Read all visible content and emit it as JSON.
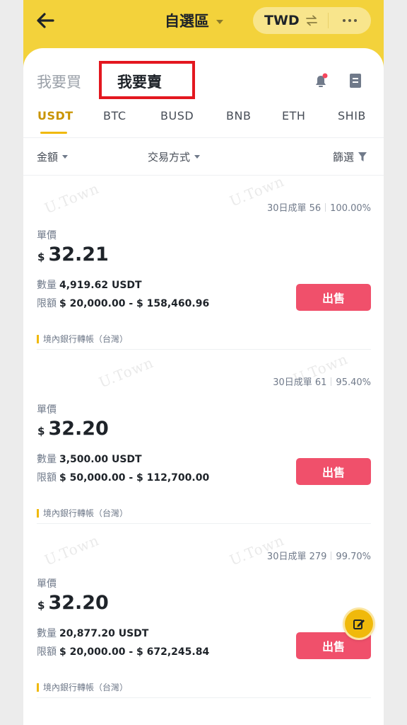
{
  "header": {
    "title": "自選區",
    "currency": "TWD"
  },
  "mode_tabs": {
    "buy": "我要買",
    "sell": "我要賣"
  },
  "coin_tabs": [
    "USDT",
    "BTC",
    "BUSD",
    "BNB",
    "ETH",
    "SHIB"
  ],
  "active_coin": "USDT",
  "filters": {
    "amount": "金額",
    "payment": "交易方式",
    "filter": "篩選"
  },
  "watermark_text": "U.Town",
  "ads": [
    {
      "stats_label": "30日成單 56",
      "completion": "100.00%",
      "price_label": "單價",
      "currency_symbol": "$",
      "price": "32.21",
      "qty_label": "數量",
      "qty": "4,919.62 USDT",
      "limit_label": "限額",
      "limit": "$ 20,000.00 - $ 158,460.96",
      "button": "出售",
      "payment": "境內銀行轉帳（台灣）"
    },
    {
      "stats_label": "30日成單 61",
      "completion": "95.40%",
      "price_label": "單價",
      "currency_symbol": "$",
      "price": "32.20",
      "qty_label": "數量",
      "qty": "3,500.00 USDT",
      "limit_label": "限額",
      "limit": "$ 50,000.00 - $ 112,700.00",
      "button": "出售",
      "payment": "境內銀行轉帳（台灣）"
    },
    {
      "stats_label": "30日成單 279",
      "completion": "99.70%",
      "price_label": "單價",
      "currency_symbol": "$",
      "price": "32.20",
      "qty_label": "數量",
      "qty": "20,877.20 USDT",
      "limit_label": "限額",
      "limit": "$ 20,000.00 - $ 672,245.84",
      "button": "出售",
      "payment": "境內銀行轉帳（台灣）"
    }
  ],
  "icons": {
    "back": "back-arrow-icon",
    "swap": "swap-icon",
    "more": "more-icon",
    "bell": "bell-icon",
    "orders": "orders-icon",
    "funnel": "funnel-icon",
    "edit": "edit-icon"
  },
  "colors": {
    "brand_yellow": "#f3d23b",
    "sell_button": "#f0506b",
    "active_tab": "#c99400",
    "highlight_box": "#e3171f"
  }
}
